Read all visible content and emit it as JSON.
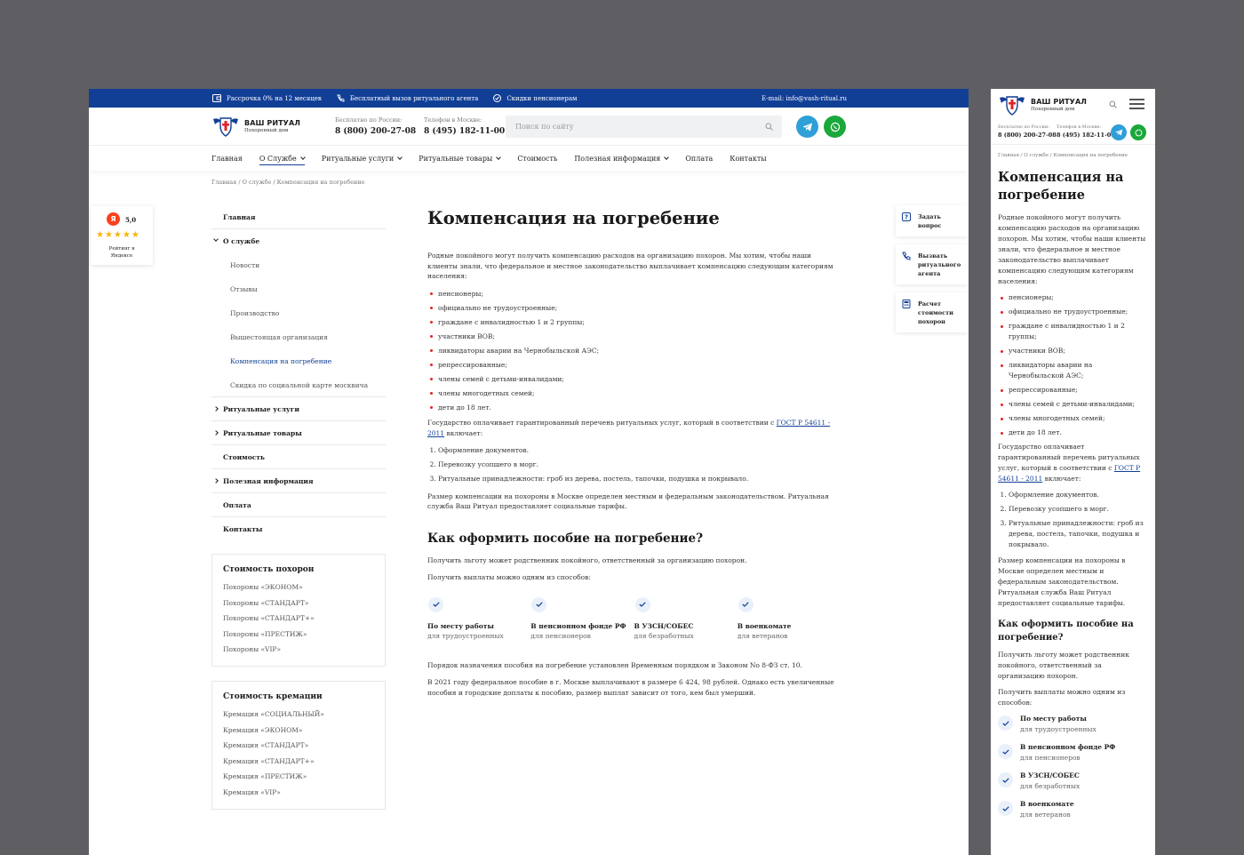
{
  "topbar": {
    "installment": "Рассрочка 0% на 12 месяцев",
    "free_call": "Бесплатный вызов ритуального агента",
    "discounts": "Скидки пенсионерам",
    "email": "E-mail: info@vash-ritual.ru"
  },
  "logo": {
    "title": "ВАШ РИТУАЛ",
    "subtitle": "Похоронный дом"
  },
  "phones": {
    "russia_label": "Бесплатно по России:",
    "russia_number": "8 (800) 200-27-08",
    "moscow_label": "Телефон в Москве:",
    "moscow_number": "8 (495) 182-11-00"
  },
  "search": {
    "placeholder": "Поиск по сайту"
  },
  "nav": [
    "Главная",
    "О Службе",
    "Ритуальные услуги",
    "Ритуальные товары",
    "Стоимость",
    "Полезная информация",
    "Оплата",
    "Контакты"
  ],
  "breadcrumb": "Главная / О службе / Компенсация на погребение",
  "rating": {
    "score": "5,0",
    "stars": "★★★★★",
    "caption": "Рейтинг в Яндексе"
  },
  "sidemenu": {
    "main": "Главная",
    "about": "О службе",
    "sub": [
      "Новости",
      "Отзывы",
      "Производство",
      "Вышестоящая организация",
      "Компенсация на погребение",
      "Скидка по социальной карте москвича"
    ],
    "services": "Ритуальные услуги",
    "goods": "Ритуальные товары",
    "cost": "Стоимость",
    "info": "Полезная информация",
    "payment": "Оплата",
    "contacts": "Контакты"
  },
  "funeral_prices": {
    "title": "Стоимость похорон",
    "items": [
      "Похороны «ЭКОНОМ»",
      "Похороны «СТАНДАРТ»",
      "Похороны «СТАНДАРТ+»",
      "Похороны «ПРЕСТИЖ»",
      "Похороны «VIP»"
    ]
  },
  "cremation_prices": {
    "title": "Стоимость кремации",
    "items": [
      "Кремация «СОЦИАЛЬНЫЙ»",
      "Кремация «ЭКОНОМ»",
      "Кремация «СТАНДАРТ»",
      "Кремация «СТАНДАРТ+»",
      "Кремация «ПРЕСТИЖ»",
      "Кремация «VIP»"
    ]
  },
  "article": {
    "title": "Компенсация на погребение",
    "intro": "Родные покойного могут получить компенсацию расходов на организацию похорон. Мы хотим, чтобы наши клиенты знали, что федеральное и местное законодательство выплачивает компенсацию следующим категориям населения:",
    "categories": [
      "пенсионеры;",
      "официально не трудоустроенные;",
      "граждане с инвалидностью 1 и 2 группы;",
      "участники ВОВ;",
      "ликвидаторы аварии на Чернобыльской АЭС;",
      "репрессированные;",
      "члены семей с детьми-инвалидами;",
      "члены многодетных семей;",
      "дети до 18 лет."
    ],
    "gov_pre": "Государство оплачивает гарантированный перечень ритуальных услуг, который в соответствии с ",
    "gost": "ГОСТ Р 54611 - 2011",
    "gov_post": " включает:",
    "services": [
      "Оформление документов.",
      "Перевозку усопшего в морг.",
      "Ритуальные принадлежности: гроб из дерева, постель, тапочки, подушка и покрывало."
    ],
    "size": "Размер компенсации на похороны в Москве определен местным и федеральным законодательством. Ритуальная служба Ваш Ритуал предоставляет социальные тарифы.",
    "h2": "Как оформить пособие на погребение?",
    "p1": "Получить льготу может родственник покойного, ответственный за организацию похорон.",
    "p2": "Получить выплаты можно одним из способов:",
    "ways": [
      {
        "title": "По месту работы",
        "sub": "для трудоустроенных"
      },
      {
        "title": "В пенсионном фонде РФ",
        "sub": "для пенсионеров"
      },
      {
        "title": "В УЗСН/СОБЕС",
        "sub": "для безработных"
      },
      {
        "title": "В военкомате",
        "sub": "для ветеранов"
      }
    ],
    "p3": "Порядок назначения пособия на погребение установлен Временным порядком и Законом No 8-ФЗ ст. 10.",
    "p4": "В 2021 году федеральное пособие в г. Москве выплачивают в размере 6 424, 98 рублей. Однако есть увеличенные пособия и городские доплаты к пособию, размер выплат зависит от того, кем был умерший."
  },
  "mobile": {
    "intro": "Родные покойного могут получить компенсацию расходов на организацию похорон. Мы хотим, чтобы наши клиенты знали, что федеральное и местное законодательство выплачивает компенсацию следующим категориям населения:",
    "gov_pre": "Государство оплачивает гарантированный перечень ритуальных услуг, который в соответствии с ",
    "gov_post": " включает:"
  },
  "actions": [
    "Задать вопрос",
    "Вызвать ритуального агента",
    "Расчет стоимости похорон"
  ]
}
